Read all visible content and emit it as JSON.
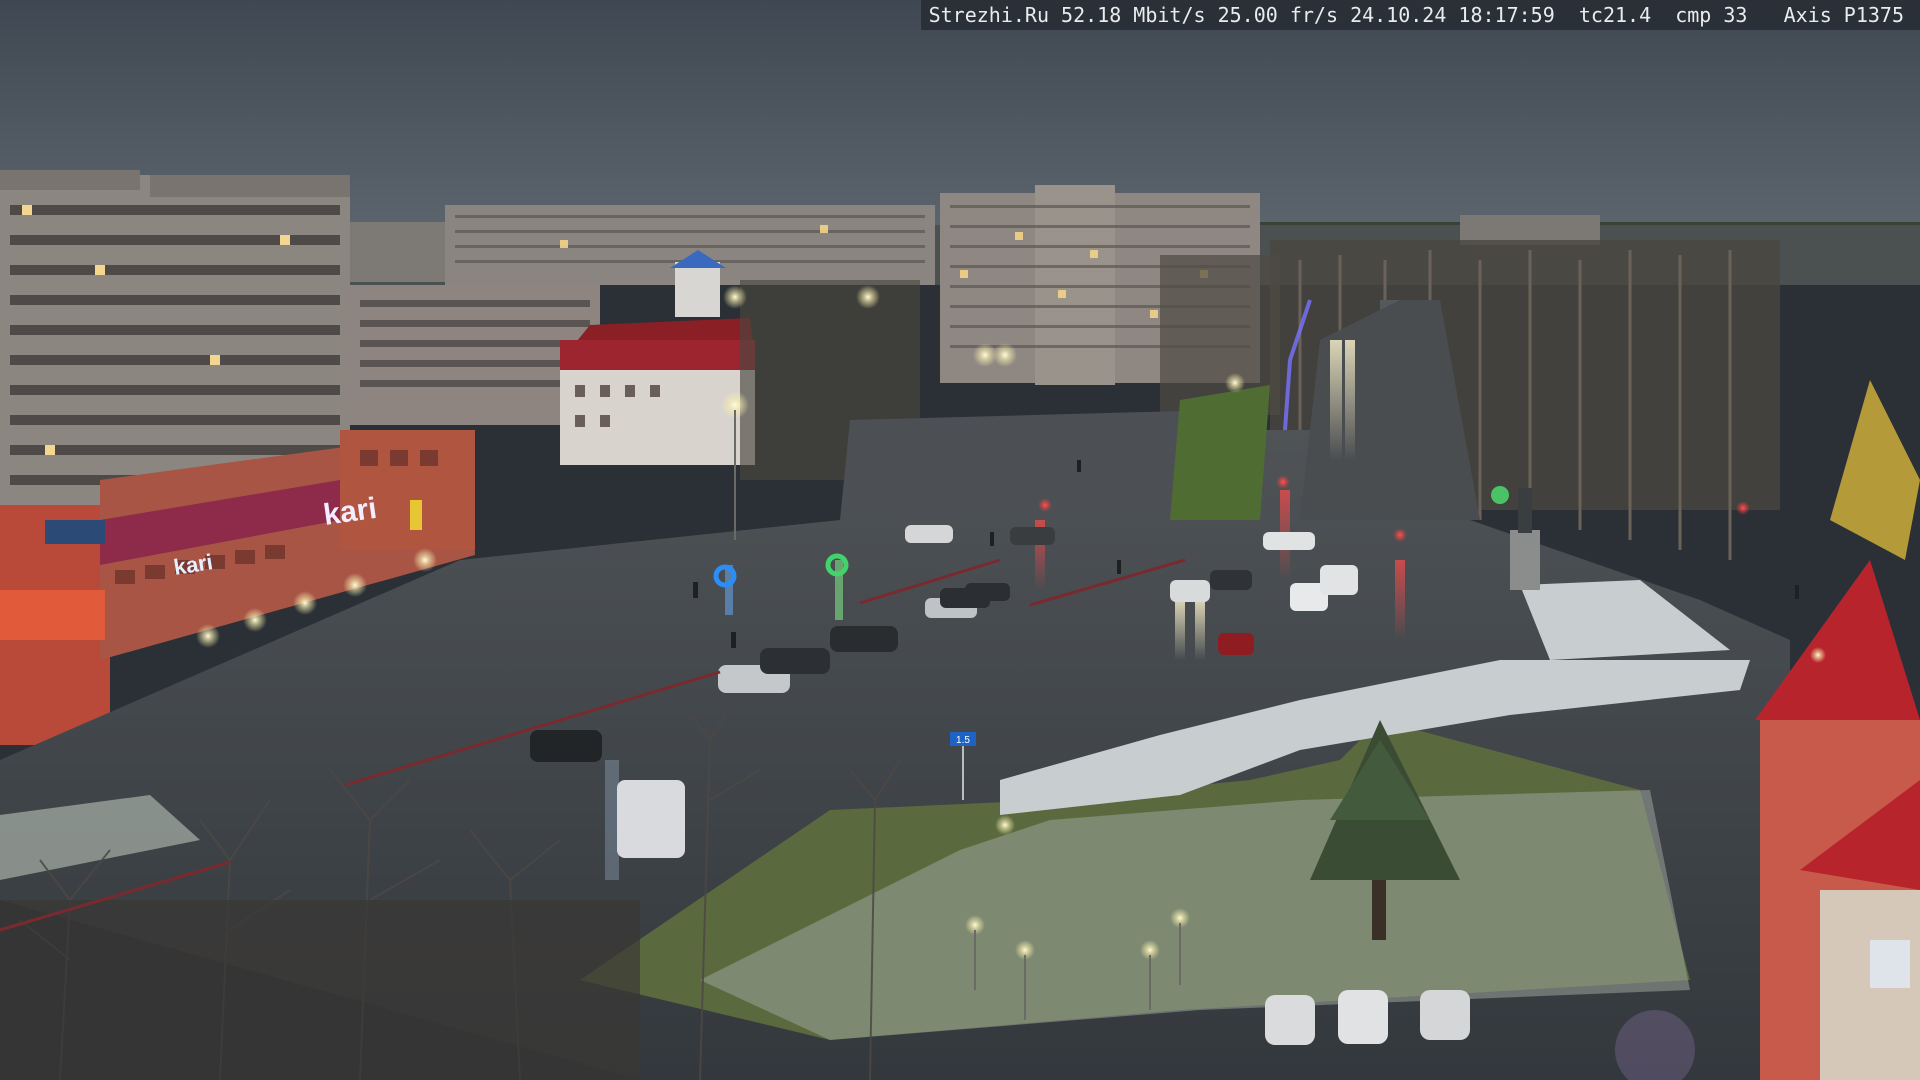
{
  "overlay": {
    "site": "Strezhi.Ru",
    "bitrate": "52.18 Mbit/s",
    "framerate": "25.00 fr/s",
    "datetime": "24.10.24 18:17:59",
    "tc": "tc21.4",
    "cmp": "cmp 33",
    "camera": "Axis P1375"
  },
  "signs": {
    "store_left": "kari",
    "store_main": "kari",
    "store_small": "",
    "road_sign": "1.5"
  },
  "colors": {
    "sky": "#4a545e",
    "asphalt": "#3c4248",
    "grass": "#5a6a3e",
    "snow": "#c8cdd0",
    "building_brick": "#a36a52",
    "building_panel": "#8a8580",
    "roof_red": "#b8242c",
    "street_light": "#f4f1c8",
    "traffic_red": "#e5333a"
  }
}
